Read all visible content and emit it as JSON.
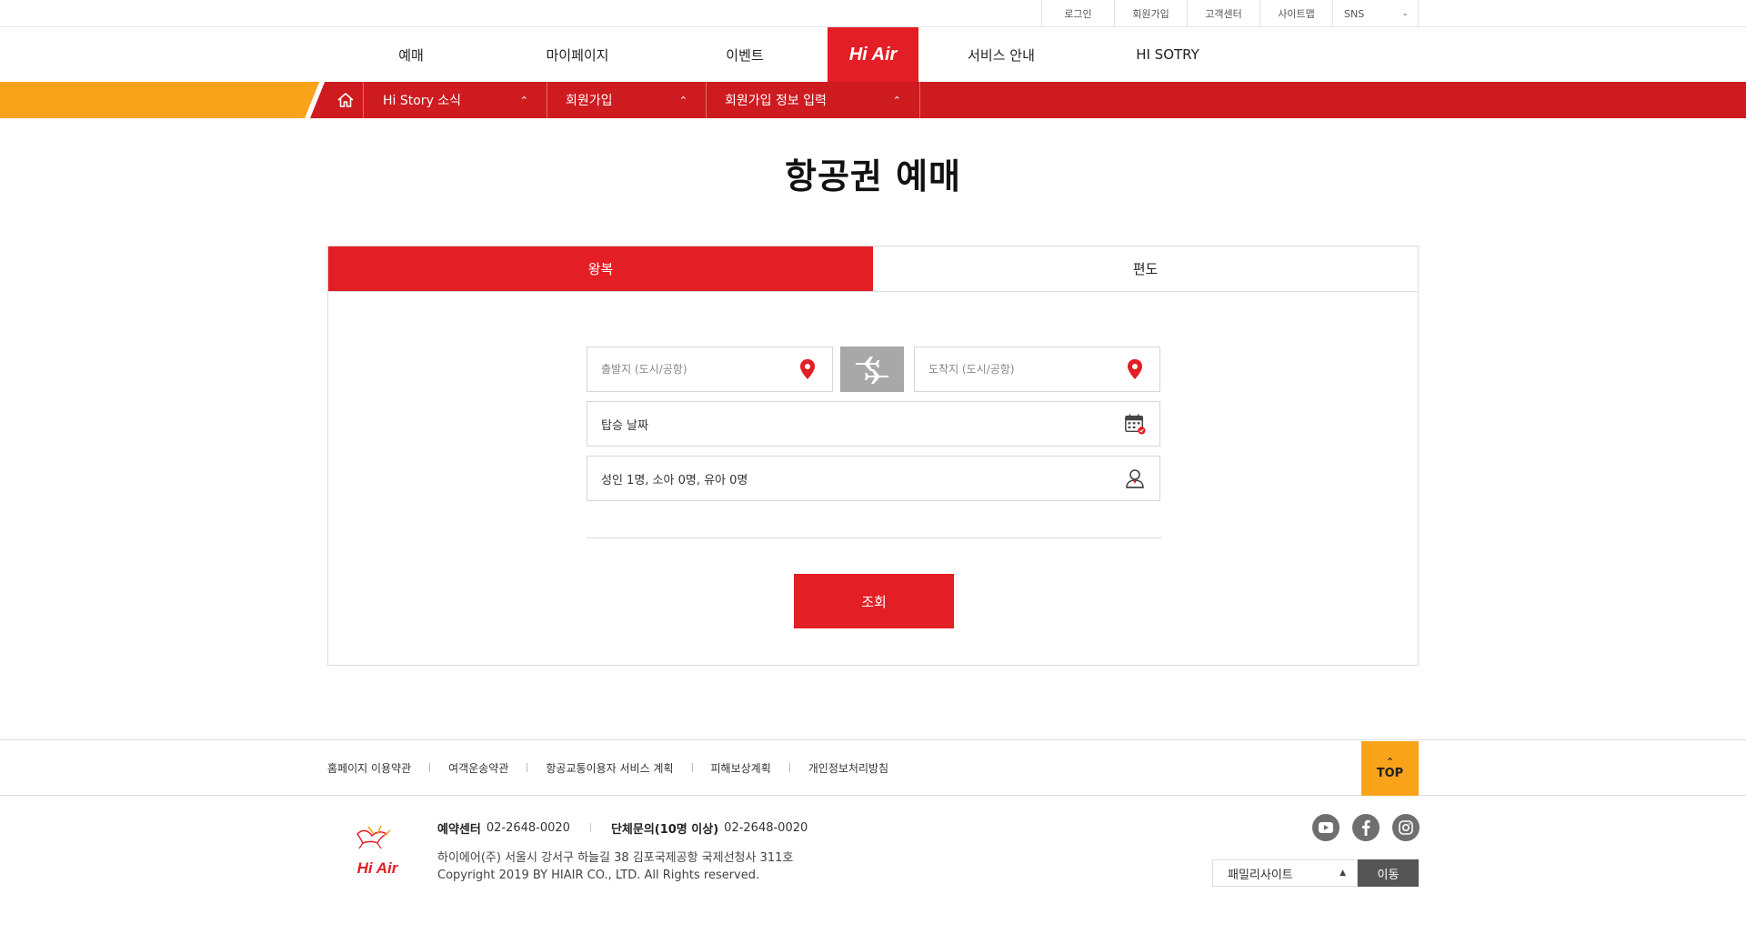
{
  "util": {
    "login": "로그인",
    "join": "회원가입",
    "support": "고객센터",
    "sitemap": "사이트맵",
    "sns": "SNS"
  },
  "nav": {
    "booking": "예매",
    "mypage": "마이페이지",
    "event": "이벤트",
    "logo": "Hi Air",
    "service": "서비스 안내",
    "story": "HI SOTRY"
  },
  "subnav": {
    "seg1": "Hi Story 소식",
    "seg2": "회원가입",
    "seg3": "회원가입 정보 입력"
  },
  "page": {
    "title": "항공권 예매"
  },
  "booking": {
    "tab_round": "왕복",
    "tab_oneway": "편도",
    "origin_placeholder": "출발지 (도시/공항)",
    "dest_placeholder": "도착지 (도시/공항)",
    "date_label": "탑승 날짜",
    "passengers": "성인 1명, 소아 0명, 유아 0명",
    "search_label": "조회"
  },
  "footer": {
    "links": [
      "홈페이지 이용약관",
      "여객운송약관",
      "항공교통이용자 서비스 계획",
      "피해보상계획",
      "개인정보처리방침"
    ],
    "top_label": "TOP",
    "reservation_label": "예약센터",
    "reservation_phone": "02-2648-0020",
    "group_label": "단체문의(10명 이상)",
    "group_phone": "02-2648-0020",
    "address": "하이에어(주) 서울시 강서구 하늘길 38 김포국제공항 국제선청사 311호",
    "copyright": "Copyright 2019 BY HIAIR CO., LTD. All Rights reserved.",
    "logo_text": "Hi Air",
    "family_label": "패밀리사이트",
    "go_label": "이동"
  },
  "colors": {
    "brand_red": "#e31e24",
    "accent_orange": "#f9a31b",
    "subnav_red": "#ce1b20"
  },
  "icons": {
    "origin": "location-pin-icon",
    "dest": "location-pin-icon",
    "swap": "airplane-swap-icon",
    "date": "calendar-icon",
    "passengers": "person-icon",
    "home": "home-icon"
  }
}
